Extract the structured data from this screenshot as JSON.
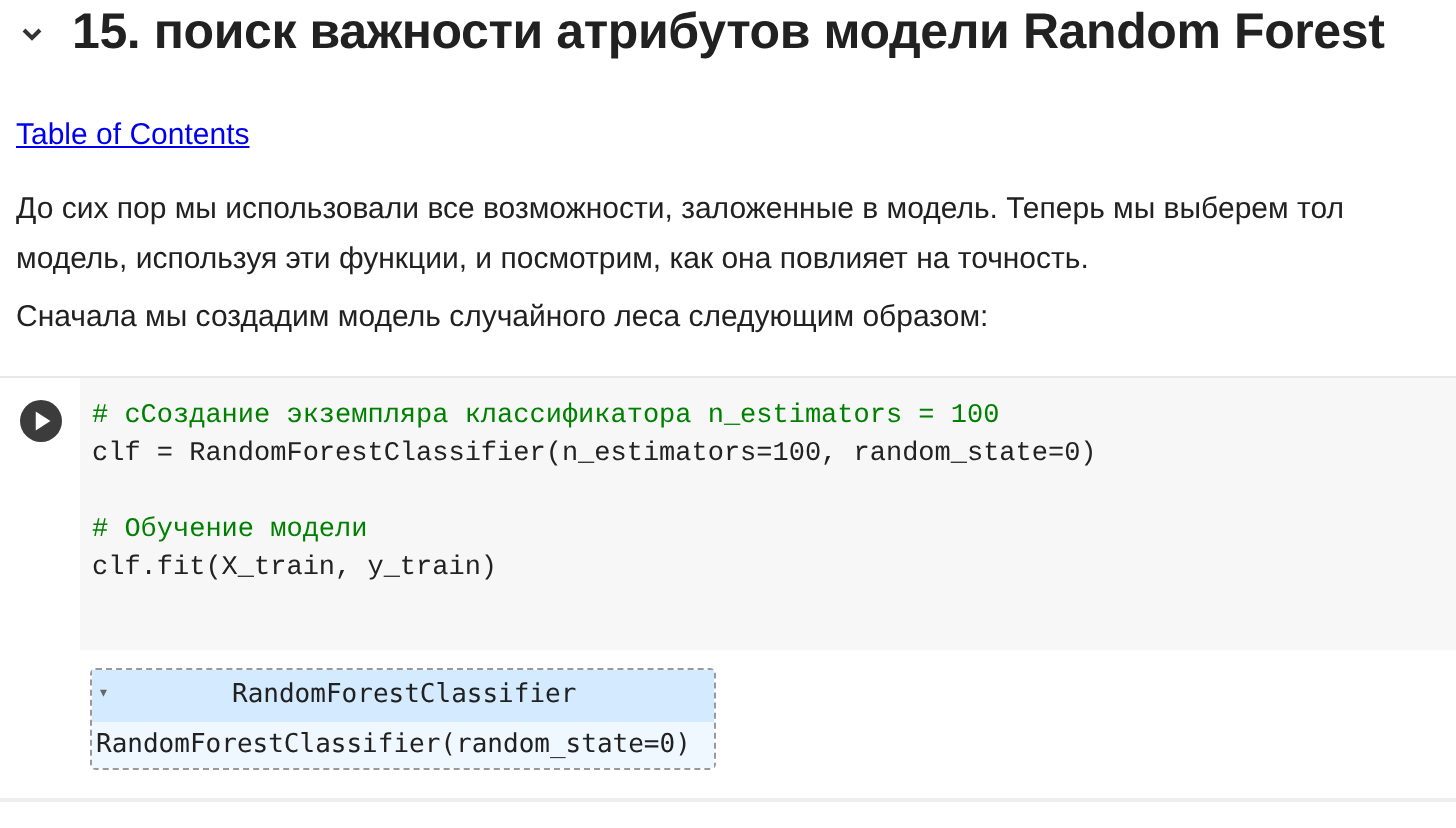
{
  "section": {
    "title": "15. поиск важности атрибутов модели Random Forest",
    "expanded": true
  },
  "link": "Table of Contents",
  "paragraph_lines": [
    "До сих пор мы использовали все возможности, заложенные в модель. Теперь мы выберем тол",
    "модель, используя эти функции, и посмотрим, как она повлияет на точность."
  ],
  "paragraph_2": "Сначала мы создадим модель случайного леса следующим образом:",
  "code_cell": {
    "lines": [
      {
        "kind": "comment",
        "text": "# сСоздание экземпляра классификатора n_estimators = 100"
      },
      {
        "kind": "code",
        "text": "clf = RandomForestClassifier(n_estimators=100, random_state=0)"
      },
      {
        "kind": "blank"
      },
      {
        "kind": "comment",
        "text": "# Обучение модели"
      },
      {
        "kind": "code",
        "text": "clf.fit(X_train, y_train)"
      }
    ]
  },
  "output_widget": {
    "toggle": "▾",
    "title": "RandomForestClassifier",
    "body": "RandomForestClassifier(random_state=0)"
  }
}
